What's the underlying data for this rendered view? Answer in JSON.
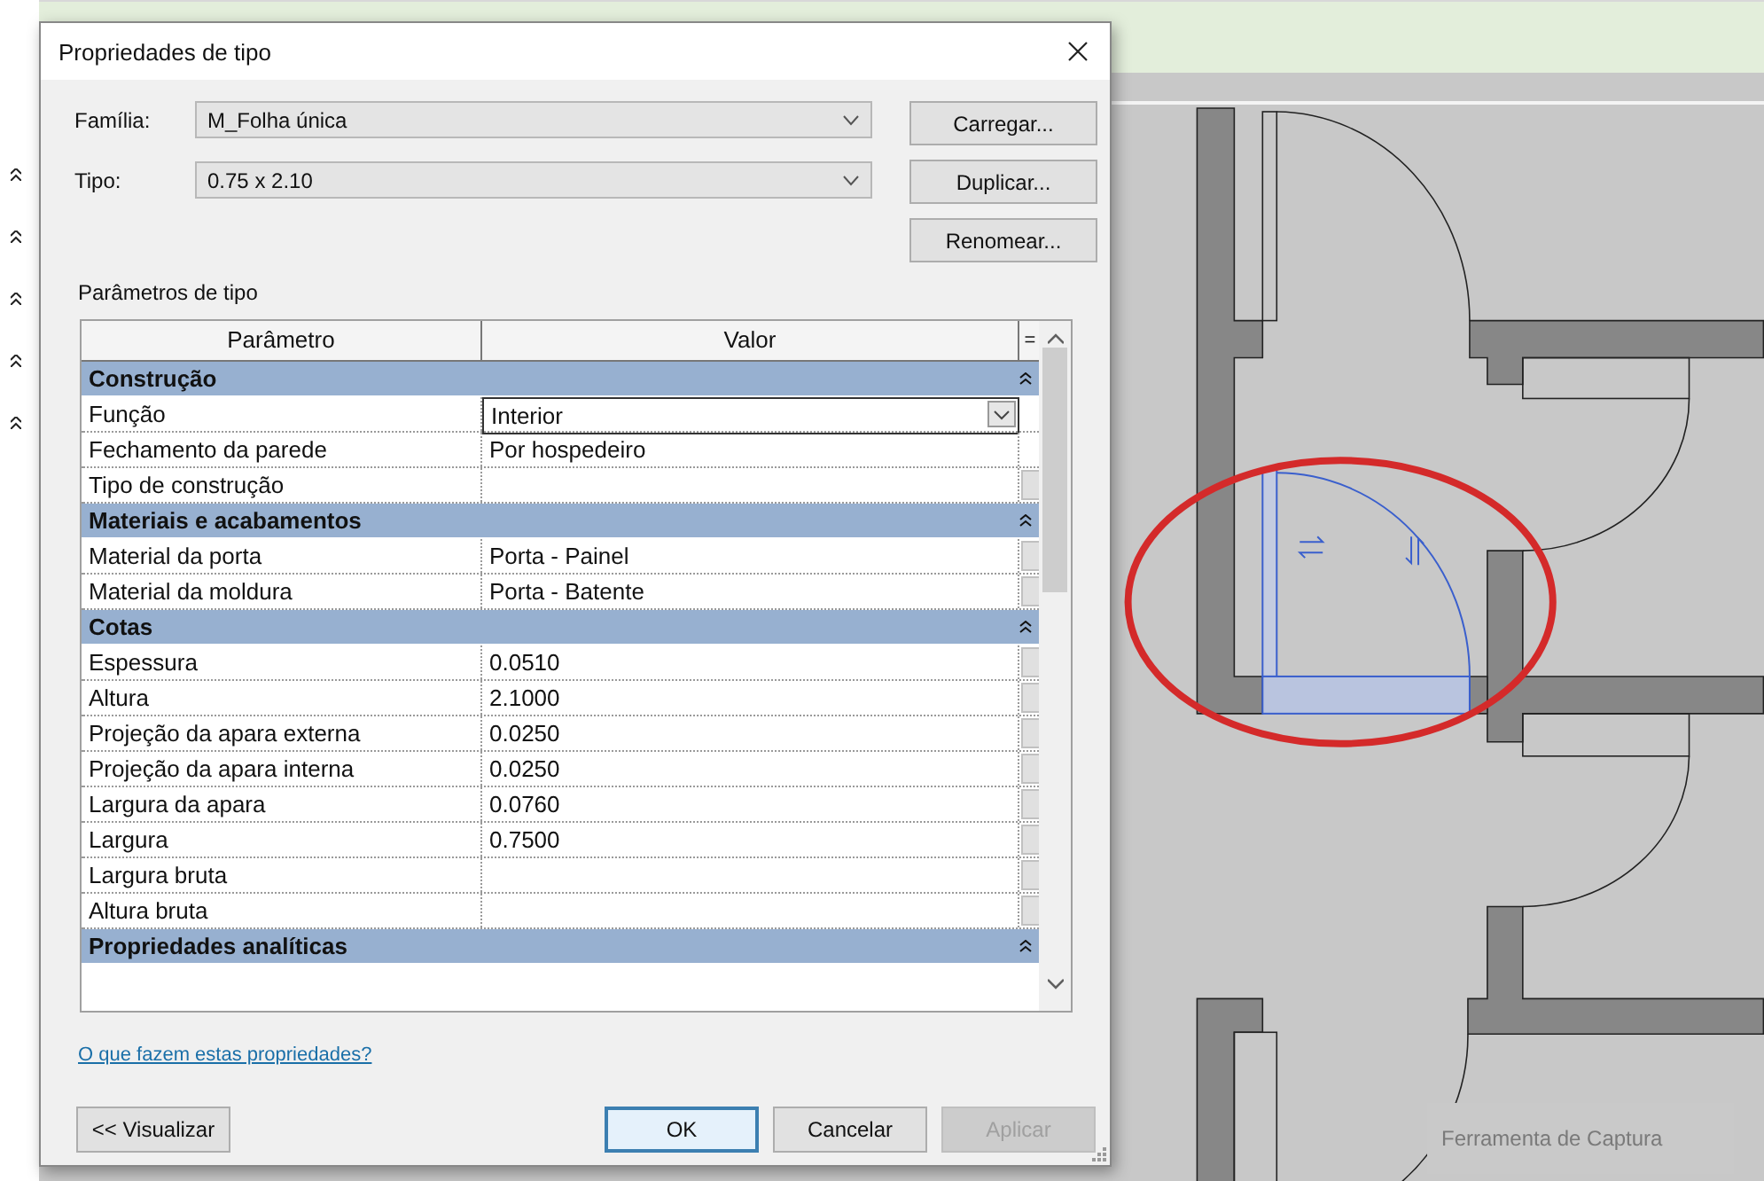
{
  "window": {
    "title": "Propriedades de tipo"
  },
  "fields": [
    {
      "label": "Família:",
      "value": "M_Folha única"
    },
    {
      "label": "Tipo:",
      "value": "0.75 x 2.10"
    }
  ],
  "side_buttons": [
    "Carregar...",
    "Duplicar...",
    "Renomear..."
  ],
  "section_label": "Parâmetros de tipo",
  "table": {
    "columns": [
      "Parâmetro",
      "Valor",
      "="
    ],
    "rows": [
      {
        "kind": "group",
        "label": "Construção",
        "expanded": true
      },
      {
        "kind": "param",
        "name": "Função",
        "value": "Interior",
        "dropdown": true,
        "edit_button": false,
        "focused": true
      },
      {
        "kind": "param",
        "name": "Fechamento da parede",
        "value": "Por hospedeiro",
        "dropdown": false,
        "edit_button": false,
        "focused": false
      },
      {
        "kind": "param",
        "name": "Tipo de construção",
        "dropdown": false,
        "edit_button": true,
        "focused": false
      },
      {
        "kind": "group",
        "label": "Materiais e acabamentos",
        "expanded": true
      },
      {
        "kind": "param",
        "name": "Material da porta",
        "value": "Porta - Painel",
        "dropdown": false,
        "edit_button": true,
        "focused": false
      },
      {
        "kind": "param",
        "name": "Material da moldura",
        "value": "Porta - Batente",
        "dropdown": false,
        "edit_button": true,
        "focused": false
      },
      {
        "kind": "group",
        "label": "Cotas",
        "expanded": true
      },
      {
        "kind": "param",
        "name": "Espessura",
        "value": "0.0510",
        "dropdown": false,
        "edit_button": true,
        "focused": false
      },
      {
        "kind": "param",
        "name": "Altura",
        "value": "2.1000",
        "dropdown": false,
        "edit_button": true,
        "focused": false
      },
      {
        "kind": "param",
        "name": "Projeção da apara externa",
        "value": "0.0250",
        "dropdown": false,
        "edit_button": true,
        "focused": false
      },
      {
        "kind": "param",
        "name": "Projeção da apara interna",
        "value": "0.0250",
        "dropdown": false,
        "edit_button": true,
        "focused": false
      },
      {
        "kind": "param",
        "name": "Largura da apara",
        "value": "0.0760",
        "dropdown": false,
        "edit_button": true,
        "focused": false
      },
      {
        "kind": "param",
        "name": "Largura",
        "value": "0.7500",
        "dropdown": false,
        "edit_button": true,
        "focused": false
      },
      {
        "kind": "param",
        "name": "Largura bruta",
        "dropdown": false,
        "edit_button": true,
        "focused": false
      },
      {
        "kind": "param",
        "name": "Altura bruta",
        "dropdown": false,
        "edit_button": true,
        "focused": false
      },
      {
        "kind": "group",
        "label": "Propriedades analíticas",
        "expanded": true
      }
    ]
  },
  "help_link": "O que fazem estas propriedades?",
  "buttons": [
    {
      "label": "<< Visualizar",
      "default": false,
      "disabled": false
    },
    {
      "label": "OK",
      "default": true,
      "disabled": false
    },
    {
      "label": "Cancelar",
      "default": false,
      "disabled": false
    },
    {
      "label": "Aplicar",
      "default": false,
      "disabled": true
    }
  ],
  "notification": {
    "title": "Ferramenta de Captura"
  }
}
